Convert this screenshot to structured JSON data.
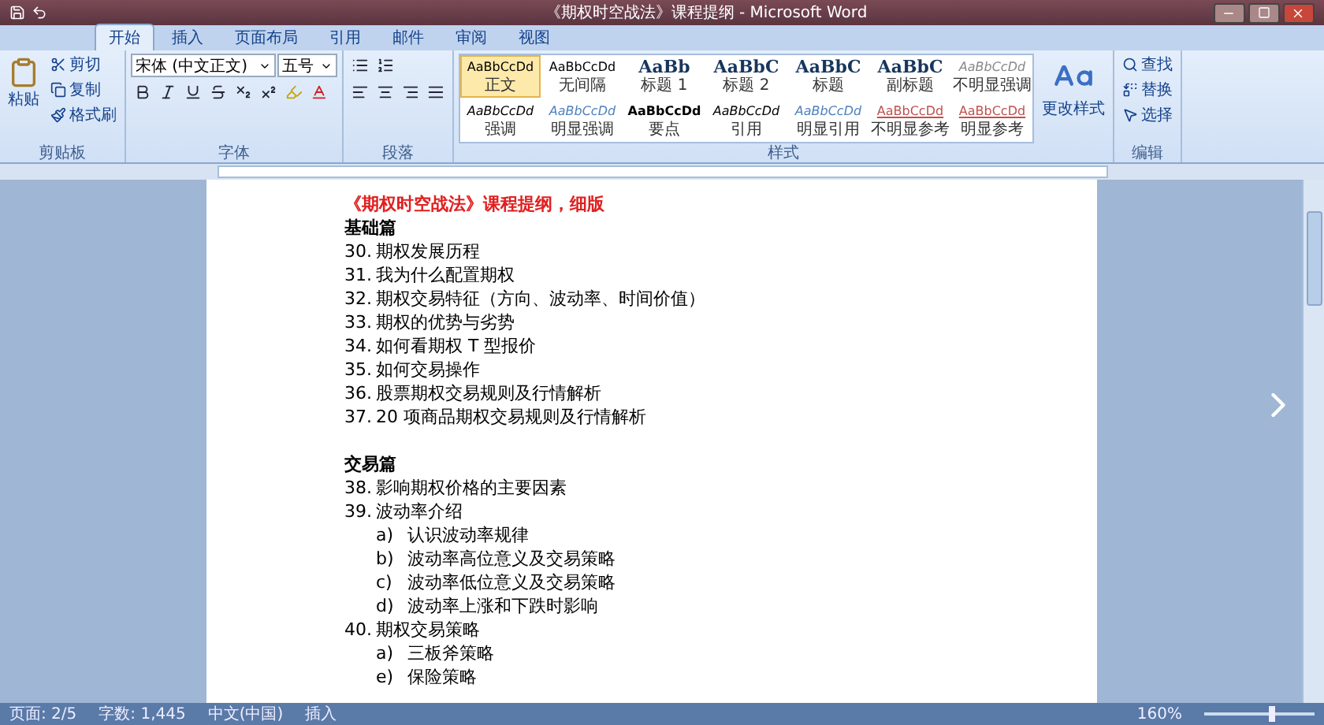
{
  "window": {
    "title": "《期权时空战法》课程提纲 - Microsoft Word"
  },
  "tabs": [
    {
      "label": "开始",
      "selected": true
    },
    {
      "label": "插入",
      "selected": false
    },
    {
      "label": "页面布局",
      "selected": false
    },
    {
      "label": "引用",
      "selected": false
    },
    {
      "label": "邮件",
      "selected": false
    },
    {
      "label": "审阅",
      "selected": false
    },
    {
      "label": "视图",
      "selected": false
    }
  ],
  "clipboard": {
    "paste": "粘贴",
    "cut": "剪切",
    "copy": "复制",
    "format_painter": "格式刷",
    "label": "剪贴板"
  },
  "font": {
    "name": "宋体 (中文正文)",
    "size": "五号",
    "label": "字体"
  },
  "paragraph": {
    "label": "段落"
  },
  "styles": {
    "label": "样式",
    "items": [
      {
        "sample": "AaBbCcDd",
        "label": "正文",
        "kind": "plain",
        "selected": true
      },
      {
        "sample": "AaBbCcDd",
        "label": "无间隔",
        "kind": "plain",
        "selected": false
      },
      {
        "sample": "AaBb",
        "label": "标题 1",
        "kind": "heading",
        "selected": false
      },
      {
        "sample": "AaBbC",
        "label": "标题 2",
        "kind": "heading",
        "selected": false
      },
      {
        "sample": "AaBbC",
        "label": "标题",
        "kind": "heading",
        "selected": false
      },
      {
        "sample": "AaBbC",
        "label": "副标题",
        "kind": "heading",
        "selected": false
      },
      {
        "sample": "AaBbCcDd",
        "label": "不明显强调",
        "kind": "subtle",
        "selected": false
      },
      {
        "sample": "AaBbCcDd",
        "label": "强调",
        "kind": "italic",
        "selected": false
      },
      {
        "sample": "AaBbCcDd",
        "label": "明显强调",
        "kind": "accent",
        "selected": false
      },
      {
        "sample": "AaBbCcDd",
        "label": "要点",
        "kind": "strong",
        "selected": false
      },
      {
        "sample": "AaBbCcDd",
        "label": "引用",
        "kind": "italic",
        "selected": false
      },
      {
        "sample": "AaBbCcDd",
        "label": "明显引用",
        "kind": "accent",
        "selected": false
      },
      {
        "sample": "AaBbCcDd",
        "label": "不明显参考",
        "kind": "reference",
        "selected": false
      },
      {
        "sample": "AaBbCcDd",
        "label": "明显参考",
        "kind": "reference",
        "selected": false
      }
    ],
    "change": "更改样式"
  },
  "editing": {
    "label": "编辑",
    "find": "查找",
    "replace": "替换",
    "select": "选择"
  },
  "document": {
    "title": "《期权时空战法》课程提纲，细版",
    "sections": [
      {
        "heading": "基础篇",
        "items": [
          {
            "number": "30.",
            "text": "期权发展历程"
          },
          {
            "number": "31.",
            "text": "我为什么配置期权"
          },
          {
            "number": "32.",
            "text": "期权交易特征（方向、波动率、时间价值）"
          },
          {
            "number": "33.",
            "text": "期权的优势与劣势"
          },
          {
            "number": "34.",
            "text": "如何看期权 T 型报价"
          },
          {
            "number": "35.",
            "text": "如何交易操作"
          },
          {
            "number": "36.",
            "text": "股票期权交易规则及行情解析"
          },
          {
            "number": "37.",
            "text": "20 项商品期权交易规则及行情解析"
          }
        ]
      },
      {
        "heading": "交易篇",
        "items": [
          {
            "number": "38.",
            "text": "影响期权价格的主要因素"
          },
          {
            "number": "39.",
            "text": "波动率介绍",
            "children": [
              {
                "number": "a)",
                "text": "认识波动率规律"
              },
              {
                "number": "b)",
                "text": "波动率高位意义及交易策略"
              },
              {
                "number": "c)",
                "text": "波动率低位意义及交易策略"
              },
              {
                "number": "d)",
                "text": "波动率上涨和下跌时影响"
              }
            ]
          },
          {
            "number": "40.",
            "text": "期权交易策略",
            "children": [
              {
                "number": "a)",
                "text": "三板斧策略"
              },
              {
                "number": "e)",
                "text": "保险策略"
              }
            ]
          }
        ]
      }
    ]
  },
  "status_bar": {
    "page": "页面: 2/5",
    "words": "字数: 1,445",
    "language": "中文(中国)",
    "mode": "插入",
    "zoom": "160%",
    "zoom_slider": {
      "level": 0.62
    }
  }
}
